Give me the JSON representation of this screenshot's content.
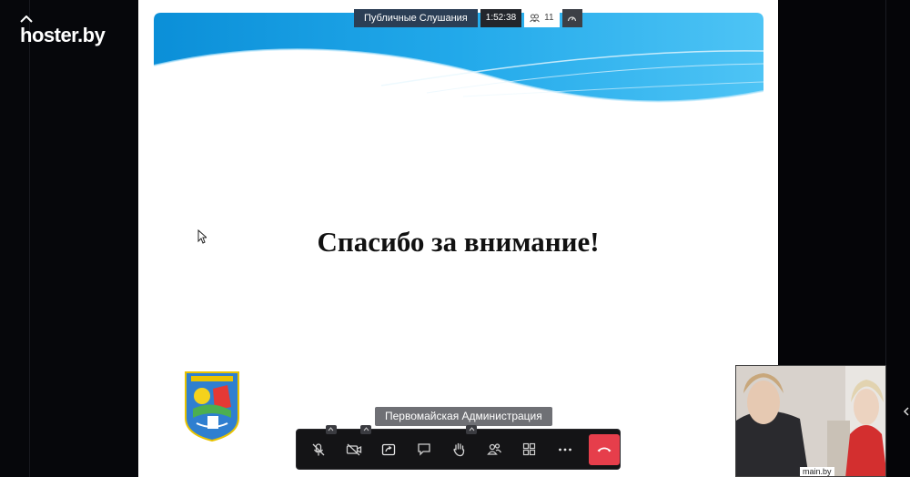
{
  "watermark": {
    "text": "hoster.by"
  },
  "meeting": {
    "title": "Публичные Слушания",
    "timer": "1:52:38",
    "participants_count": "11"
  },
  "slide": {
    "heading": "Спасибо за внимание!",
    "banner_colors": [
      "#0a8fd6",
      "#4fc3f7"
    ]
  },
  "speaker": {
    "name": "Первомайская Администрация"
  },
  "thumbnail": {
    "label": "main.by"
  },
  "toolbar": {
    "buttons": [
      {
        "name": "microphone-muted-button",
        "icon": "mic-off-icon"
      },
      {
        "name": "camera-off-button",
        "icon": "camera-off-icon"
      },
      {
        "name": "screen-share-button",
        "icon": "share-screen-icon"
      },
      {
        "name": "chat-button",
        "icon": "chat-icon"
      },
      {
        "name": "raise-hand-button",
        "icon": "hand-icon"
      },
      {
        "name": "participants-button",
        "icon": "people-icon"
      },
      {
        "name": "tile-view-button",
        "icon": "grid-icon"
      },
      {
        "name": "more-button",
        "icon": "more-icon"
      },
      {
        "name": "leave-call-button",
        "icon": "hangup-icon"
      }
    ],
    "hangup_color": "#e63e4b"
  }
}
